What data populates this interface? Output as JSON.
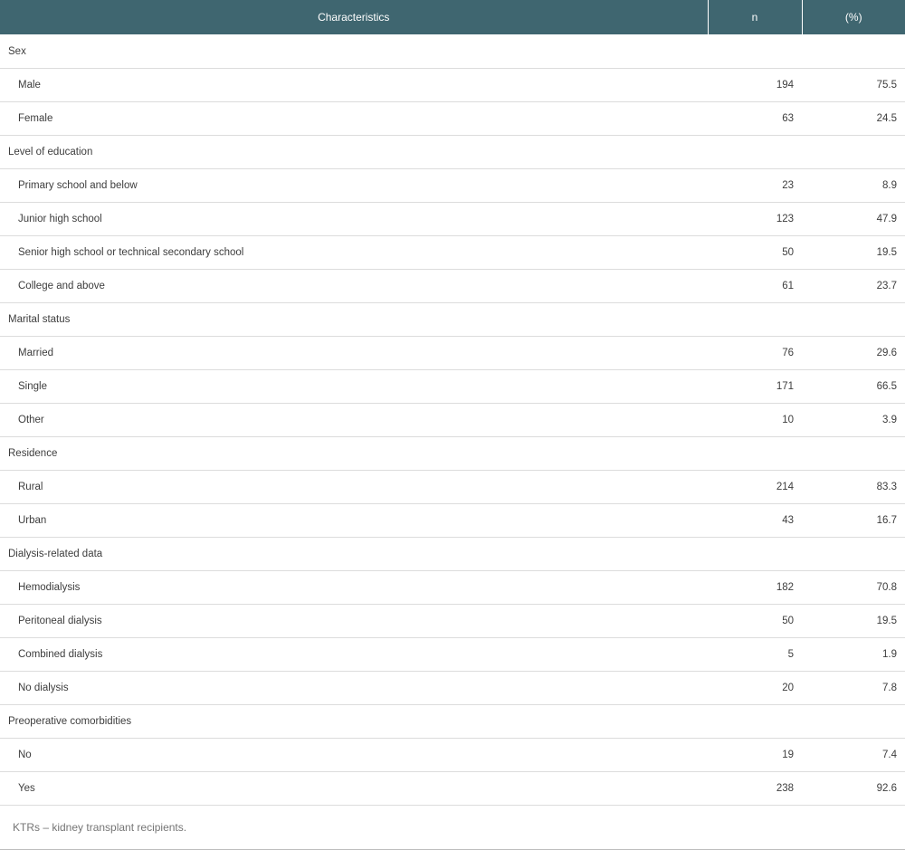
{
  "table": {
    "headers": {
      "characteristics": "Characteristics",
      "n": "n",
      "percent": "(%)"
    },
    "groups": [
      {
        "label": "Sex",
        "rows": [
          {
            "label": "Male",
            "n": "194",
            "pct": "75.5"
          },
          {
            "label": "Female",
            "n": "63",
            "pct": "24.5"
          }
        ]
      },
      {
        "label": "Level of education",
        "rows": [
          {
            "label": "Primary school and below",
            "n": "23",
            "pct": "8.9"
          },
          {
            "label": "Junior high school",
            "n": "123",
            "pct": "47.9"
          },
          {
            "label": "Senior high school or technical secondary school",
            "n": "50",
            "pct": "19.5"
          },
          {
            "label": "College and above",
            "n": "61",
            "pct": "23.7"
          }
        ]
      },
      {
        "label": "Marital status",
        "rows": [
          {
            "label": "Married",
            "n": "76",
            "pct": "29.6"
          },
          {
            "label": "Single",
            "n": "171",
            "pct": "66.5"
          },
          {
            "label": "Other",
            "n": "10",
            "pct": "3.9"
          }
        ]
      },
      {
        "label": "Residence",
        "rows": [
          {
            "label": "Rural",
            "n": "214",
            "pct": "83.3"
          },
          {
            "label": "Urban",
            "n": "43",
            "pct": "16.7"
          }
        ]
      },
      {
        "label": "Dialysis-related data",
        "rows": [
          {
            "label": "Hemodialysis",
            "n": "182",
            "pct": "70.8"
          },
          {
            "label": "Peritoneal dialysis",
            "n": "50",
            "pct": "19.5"
          },
          {
            "label": "Combined dialysis",
            "n": "5",
            "pct": "1.9"
          },
          {
            "label": "No dialysis",
            "n": "20",
            "pct": "7.8"
          }
        ]
      },
      {
        "label": "Preoperative comorbidities",
        "rows": [
          {
            "label": "No",
            "n": "19",
            "pct": "7.4"
          },
          {
            "label": "Yes",
            "n": "238",
            "pct": "92.6"
          }
        ]
      }
    ],
    "footnote": "KTRs – kidney transplant recipients."
  },
  "colors": {
    "header_bg": "#3f6670",
    "header_text": "#ffffff",
    "row_border": "#dcdcdc"
  }
}
